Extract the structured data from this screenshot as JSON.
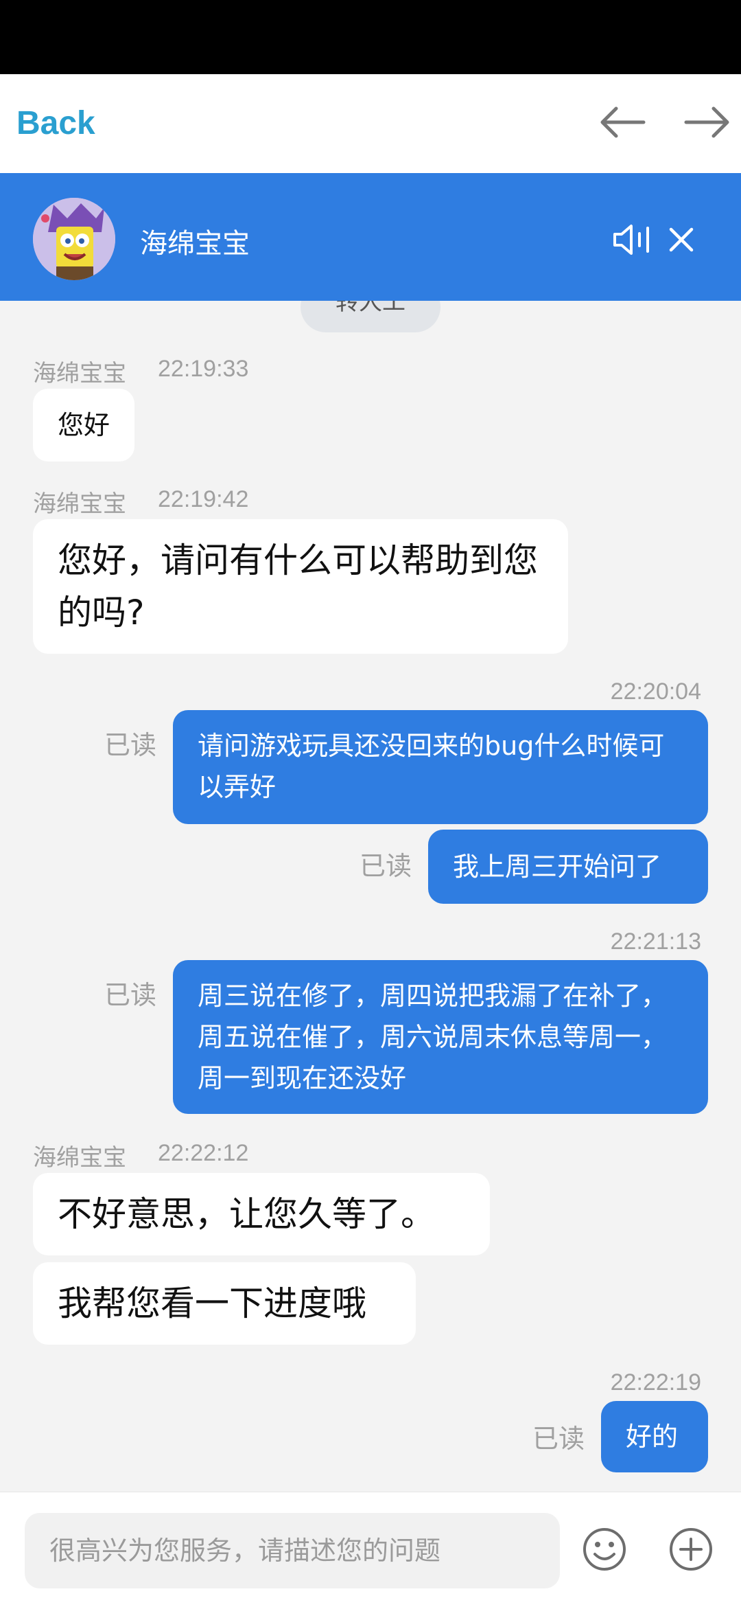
{
  "nav": {
    "back_label": "Back"
  },
  "header": {
    "agent_name": "海绵宝宝",
    "transfer_label": "转人工"
  },
  "messages": [
    {
      "sender": "海绵宝宝",
      "time": "22:19:33",
      "text": "您好"
    },
    {
      "sender": "海绵宝宝",
      "time": "22:19:42",
      "text": "您好，请问有什么可以帮助到您的吗?"
    },
    {
      "time": "22:20:04",
      "read": "已读",
      "text": "请问游戏玩具还没回来的bug什么时候可以弄好"
    },
    {
      "read": "已读",
      "text": "我上周三开始问了"
    },
    {
      "time": "22:21:13",
      "read": "已读",
      "text": "周三说在修了，周四说把我漏了在补了，周五说在催了，周六说周末休息等周一，周一到现在还没好"
    },
    {
      "sender": "海绵宝宝",
      "time": "22:22:12",
      "text": "不好意思，让您久等了。"
    },
    {
      "text": "我帮您看一下进度哦"
    },
    {
      "time": "22:22:19",
      "read": "已读",
      "text": "好的"
    }
  ],
  "input": {
    "placeholder": "很高兴为您服务，请描述您的问题"
  },
  "icons": {
    "back_arrow": "arrow-left-icon",
    "forward_arrow": "arrow-right-icon",
    "speaker": "speaker-icon",
    "close": "close-icon",
    "emoji": "emoji-icon",
    "plus": "plus-icon"
  },
  "colors": {
    "accent": "#2f7de1",
    "back_link": "#2a9fd0",
    "background": "#f3f3f3"
  }
}
